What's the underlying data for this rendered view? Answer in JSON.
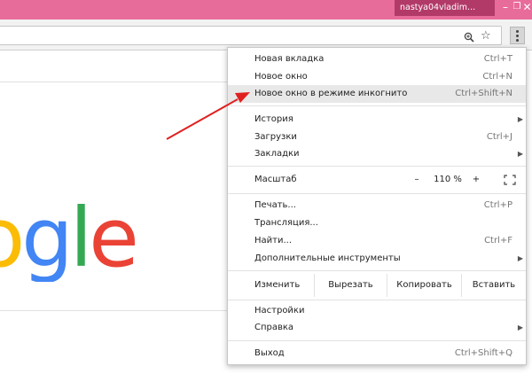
{
  "titlebar": {
    "profile_name": "nastya04vladim...",
    "minimize": "–",
    "maximize": "❐",
    "close": "✕"
  },
  "toolbar": {
    "zoom_icon": "magnifier-icon",
    "star_icon": "bookmark-star-icon",
    "menu_icon": "kebab-menu-icon"
  },
  "page": {
    "logo_letters": [
      "o",
      "g",
      "l",
      "e"
    ],
    "logo_colors": [
      "#fbbc05",
      "#4285f4",
      "#34a853",
      "#ea4335"
    ]
  },
  "menu": {
    "items_top": [
      {
        "label": "Новая вкладка",
        "shortcut": "Ctrl+T"
      },
      {
        "label": "Новое окно",
        "shortcut": "Ctrl+N"
      },
      {
        "label": "Новое окно в режиме инкогнито",
        "shortcut": "Ctrl+Shift+N"
      }
    ],
    "items_history": [
      {
        "label": "История",
        "shortcut": ""
      },
      {
        "label": "Загрузки",
        "shortcut": "Ctrl+J"
      },
      {
        "label": "Закладки",
        "shortcut": ""
      }
    ],
    "zoom": {
      "label": "Масштаб",
      "minus": "–",
      "value": "110 %",
      "plus": "+"
    },
    "items_tools": [
      {
        "label": "Печать...",
        "shortcut": "Ctrl+P"
      },
      {
        "label": "Трансляция...",
        "shortcut": ""
      },
      {
        "label": "Найти...",
        "shortcut": "Ctrl+F"
      },
      {
        "label": "Дополнительные инструменты",
        "shortcut": ""
      }
    ],
    "edit": {
      "label": "Изменить",
      "cut": "Вырезать",
      "copy": "Копировать",
      "paste": "Вставить"
    },
    "items_settings": [
      {
        "label": "Настройки",
        "shortcut": ""
      },
      {
        "label": "Справка",
        "shortcut": ""
      }
    ],
    "exit": {
      "label": "Выход",
      "shortcut": "Ctrl+Shift+Q"
    }
  },
  "colors": {
    "titlebar": "#e86c9a",
    "profile_chip": "#b23a68",
    "annotation_arrow": "#e02020",
    "highlight": "#e8e8e8"
  }
}
